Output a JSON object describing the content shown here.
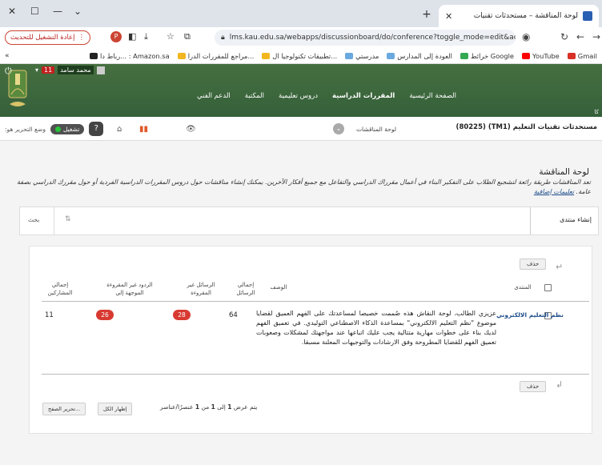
{
  "browser": {
    "tab_title": "لوحة المناقشة – مستحدثات تقنيات",
    "url": "lms.kau.edu.sa/webapps/discussionboard/do/conference?toggle_mode=edit&action=list_fo...",
    "restart_label": "إعادة التشغيل للتحديث",
    "bookmarks": [
      {
        "label": "Gmail",
        "color": "#d93025"
      },
      {
        "label": "YouTube",
        "color": "#ff0000"
      },
      {
        "label": "خرائط Google",
        "color": "#34a853"
      },
      {
        "label": "العودة إلى المدارس",
        "color": "#6aa9e0"
      },
      {
        "label": "مدرستي",
        "color": "#6aa9e0"
      },
      {
        "label": "تطبيقات تكنولوجيا ال...",
        "color": "#f2b61f"
      },
      {
        "label": "مراجع للمقررات الدرا...",
        "color": "#f2b61f"
      },
      {
        "label": "رباط دا... : Amazon.sa",
        "color": "#222"
      }
    ]
  },
  "site": {
    "user_name": "محمد سامد",
    "notif_count": "11",
    "nav": [
      "الصفحة الرئيسية",
      "المقررات الدراسية",
      "دروس تعليمية",
      "المكتبة",
      "الدعم الفني"
    ],
    "kau": "كا"
  },
  "course": {
    "title": "مستحدثات تقنيات التعليم (TM1) (80225)",
    "breadcrumb": "لوحة المناقشات",
    "edit_mode_label": "وضع التحرير هو:",
    "edit_mode_value": "تشغيل"
  },
  "page": {
    "title": "لوحة المناقشة",
    "description": "تعد المناقشات طريقة رائعة لتشجيع الطلاب على التفكير البناء في أعمال مقرراك الدراسي والتفاعل مع جميع أفكار الآخرين. يمكنك إنشاء مناقشات حول دروس المقررات الدراسية الفردية أو حول مقررك الدراسي بصفة عامة.",
    "more_link": "تعليمات إضافية",
    "create_forum": "إنشاء منتدى",
    "search": "بحث"
  },
  "table": {
    "delete_label": "حذف",
    "headers": {
      "forum": "المنتدى",
      "description": "الوصف",
      "total_posts": "إجمالي الرسائل",
      "unread_posts": "الرسائل غير المقروءة",
      "unread_replies": "الردود غير المقروءة الموجهة إلي",
      "total_participants": "إجمالي المشاركين"
    },
    "rows": [
      {
        "forum": "نظم التعليم الالكتروني",
        "description": "عزيزي الطالب، لوحة النقاش هذه صُممت خصيصا لمساعدتك على الفهم العميق لقضايا موضوع \"نظم التعليم الالكتروني\" بمساعدة الذكاء الاصطناعي التوليدي. في تعميق الفهم لديك بناء على خطوات مهارية متتالية يجب عليك اتباعها عند مواجهتك لمشكلات وصعوبات تعميق الفهم للقضايا المطروحة وفق الارشادات والتوجيهات المعلنة مسبقا.",
        "total_posts": "64",
        "unread_posts": "28",
        "unread_replies": "26",
        "total_participants": "11"
      }
    ],
    "pager": {
      "showing_prefix": "يتم عرض",
      "from": "1",
      "to_word": "إلى",
      "to": "1",
      "of_word": "من",
      "total": "1",
      "suffix": "عنصرًا/عناصر",
      "show_all": "إظهار الكل",
      "edit_paging": "تحرير الصفح..."
    }
  }
}
